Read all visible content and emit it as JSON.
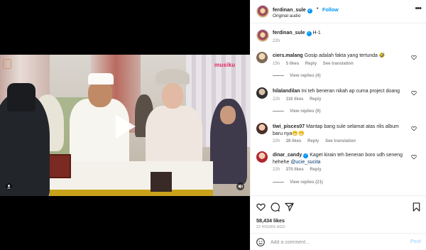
{
  "watermark": {
    "text": "musiku"
  },
  "header": {
    "username": "ferdinan_sule",
    "verified_mark": "✓",
    "separator": "•",
    "follow_label": "Follow",
    "audio": "Original audio",
    "more_label": "•••"
  },
  "caption": {
    "username": "ferdinan_sule",
    "verified_mark": "✓",
    "text": "H-1",
    "time": "22h"
  },
  "comments": [
    {
      "username": "ciers.malang",
      "text": "Gosip adalah fakta yang tertunda 🤣",
      "time": "15h",
      "likes": "5 likes",
      "reply": "Reply",
      "translate": "See translation",
      "view_replies": "View replies (4)"
    },
    {
      "username": "hilalandilan",
      "text": "Ini teh beneran nikah ap cuma project doang",
      "time": "22h",
      "likes": "116 likes",
      "reply": "Reply",
      "translate": "",
      "view_replies": "View replies (9)"
    },
    {
      "username": "tiwi_pisces07",
      "text": "Mantap bang sule selamat atas rilis album baru nya😁😁",
      "time": "22h",
      "likes": "28 likes",
      "reply": "Reply",
      "translate": "See translation",
      "view_replies": ""
    },
    {
      "username": "dinar_candy",
      "verified_mark": "✓",
      "text": "Kaget kirain teh beneran boro udh seneng hehehe",
      "mention": "@ucie_sucita",
      "time": "22h",
      "likes": "270 likes",
      "reply": "Reply",
      "translate": "",
      "view_replies": "View replies (21)"
    }
  ],
  "stats": {
    "likes": "58,434 likes",
    "ago": "22 HOURS AGO"
  },
  "composer": {
    "placeholder": "Add a comment...",
    "post_label": "Post"
  },
  "colors": {
    "accent": "#0095f6",
    "post_disabled": "#b3dbff",
    "muted_text": "#8e8e8e"
  },
  "icons": [
    "play-icon",
    "user-tag-icon",
    "mute-icon",
    "heart-icon",
    "comment-icon",
    "share-icon",
    "bookmark-icon",
    "emoji-icon",
    "more-icon",
    "verified-icon"
  ]
}
